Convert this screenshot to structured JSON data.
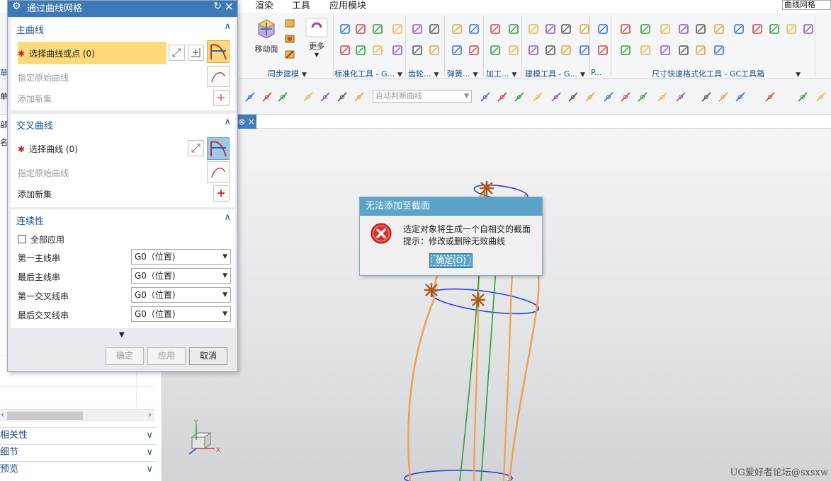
{
  "ribbon": {
    "tabs": [
      "渲染",
      "工具",
      "应用模块"
    ],
    "search_value": "曲线网格",
    "move_face_label": "移动面",
    "more_label": "更多",
    "groups": [
      {
        "label": "同步建模"
      },
      {
        "label": "标准化工具 - G..."
      },
      {
        "label": "齿轮..."
      },
      {
        "label": "弹簧..."
      },
      {
        "label": "加工..."
      },
      {
        "label": "建模工具 - G..."
      },
      {
        "label": "P..."
      },
      {
        "label": "尺寸快速格式化工具 - GC工具箱"
      }
    ],
    "left_cut_labels": [
      "草",
      "单(",
      "部",
      "名"
    ]
  },
  "selection_toolbar": {
    "curve_rule": "自动判断曲线"
  },
  "navigator": {
    "sections": [
      "相关性",
      "细节",
      "预览"
    ]
  },
  "graphics": {
    "tab_label": "⊗ ×",
    "watermark": "UG爱好者论坛@sxsxw",
    "axis_labels": {
      "x": "X",
      "y": "Y"
    }
  },
  "dialog": {
    "title": "通过曲线网格",
    "primary_curves": {
      "header": "主曲线",
      "select_label": "选择曲线或点 (0)",
      "specify_origin": "指定原始曲线",
      "add_new_set": "添加新集"
    },
    "cross_curves": {
      "header": "交叉曲线",
      "select_label": "选择曲线 (0)",
      "specify_origin": "指定原始曲线",
      "add_new_set": "添加新集"
    },
    "continuity": {
      "header": "连续性",
      "apply_all": "全部应用",
      "rows": [
        {
          "label": "第一主线串",
          "value": "G0（位置)"
        },
        {
          "label": "最后主线串",
          "value": "G0（位置)"
        },
        {
          "label": "第一交叉线串",
          "value": "G0（位置)"
        },
        {
          "label": "最后交叉线串",
          "value": "G0（位置)"
        }
      ]
    },
    "buttons": {
      "ok": "确定",
      "apply": "应用",
      "cancel": "取消"
    }
  },
  "error_dialog": {
    "title": "无法添加至截面",
    "message": "选定对象将生成一个自相交的截面",
    "hint": "提示：修改或删除无效曲线",
    "ok_label": "确定(O)"
  },
  "colors": {
    "dialog_title": "#3d79b6",
    "active_row": "#ffd97a",
    "error_title": "#5ba3c8",
    "curve_orange": "#f2a04a",
    "curve_green": "#2e9e3a",
    "curve_blue": "#2c3fe0"
  }
}
